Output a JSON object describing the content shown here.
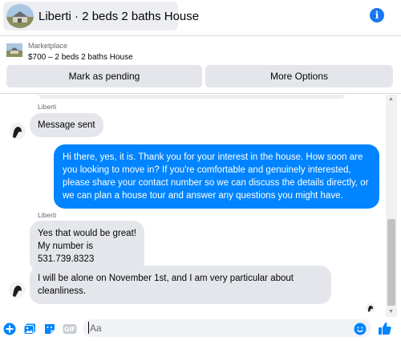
{
  "header": {
    "title": "Liberti · 2 beds 2 baths House",
    "info_icon": "info-icon"
  },
  "listing": {
    "source_label": "Marketplace",
    "price_line": "$700 – 2 beds 2 baths House",
    "mark_pending_label": "Mark as pending",
    "more_options_label": "More Options"
  },
  "conversation": {
    "messages": [
      {
        "sender": "Liberti",
        "direction": "incoming",
        "text": "Message sent"
      },
      {
        "direction": "outgoing",
        "text": "Hi there, yes, it is. Thank you for your interest in the house. How soon are you looking to move in? If you're comfortable and genuinely interested, please share your contact number so we can discuss the details directly, or we can plan a house tour and answer any questions you might have."
      },
      {
        "sender": "Liberti",
        "direction": "incoming",
        "text": "Yes that would be great!\nMy number is\n531.739.8323"
      },
      {
        "direction": "incoming",
        "text": "I will be alone on November 1st, and I am very particular about cleanliness."
      }
    ]
  },
  "composer": {
    "placeholder": "Aa",
    "icons": [
      "plus-circle-icon",
      "photo-icon",
      "sticker-icon",
      "gif-icon",
      "emoji-icon",
      "thumbs-up-icon"
    ]
  },
  "colors": {
    "accent": "#0084ff",
    "brand_blue": "#1877f2",
    "incoming_bubble": "#e4e6eb",
    "button_bg": "#e4e6eb"
  }
}
